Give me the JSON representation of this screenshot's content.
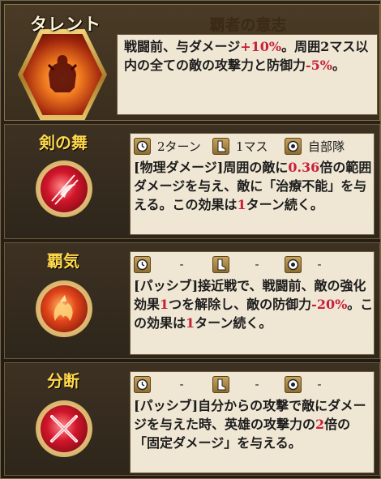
{
  "talent": {
    "label": "タレント",
    "title": "覇者の意志",
    "desc": [
      {
        "t": "戦闘前、与ダメージ"
      },
      {
        "t": "+10%",
        "red": true
      },
      {
        "t": "。周囲2マス以内の全ての敵の攻撃力と防御力"
      },
      {
        "t": "-5%",
        "red": true
      },
      {
        "t": "。"
      }
    ]
  },
  "skills": [
    {
      "name": "剣の舞",
      "icon": "sword-dance-icon",
      "stats": {
        "cooldown": "2ターン",
        "range": "1マス",
        "target": "自部隊"
      },
      "desc": [
        {
          "t": "[物理ダメージ]周囲の敵に"
        },
        {
          "t": "0.36",
          "red": true
        },
        {
          "t": "倍の範囲ダメージを与え、敵に「治療不能」を与える。この効果は"
        },
        {
          "t": "1",
          "red": true
        },
        {
          "t": "ターン続く。"
        }
      ]
    },
    {
      "name": "覇気",
      "icon": "dragon-aura-icon",
      "stats": {
        "cooldown": "-",
        "range": "-",
        "target": "-"
      },
      "desc": [
        {
          "t": "[パッシブ]接近戦で、戦闘前、敵の強化効果"
        },
        {
          "t": "1",
          "red": true
        },
        {
          "t": "つを解除し、敵の防御力"
        },
        {
          "t": "-20%",
          "red": true
        },
        {
          "t": "。この効果は"
        },
        {
          "t": "1",
          "red": true
        },
        {
          "t": "ターン続く。"
        }
      ]
    },
    {
      "name": "分断",
      "icon": "crossed-blades-icon",
      "stats": {
        "cooldown": "-",
        "range": "-",
        "target": "-"
      },
      "desc": [
        {
          "t": "[パッシブ]自分からの攻撃で敵にダメージを与えた時、英雄の攻撃力の"
        },
        {
          "t": "2",
          "red": true
        },
        {
          "t": "倍の「固定ダメージ」を与える。"
        }
      ]
    }
  ],
  "colors": {
    "highlight": "#c8203a",
    "name_gold": "#ffd84a",
    "panel_bg": "#efe6d3"
  }
}
